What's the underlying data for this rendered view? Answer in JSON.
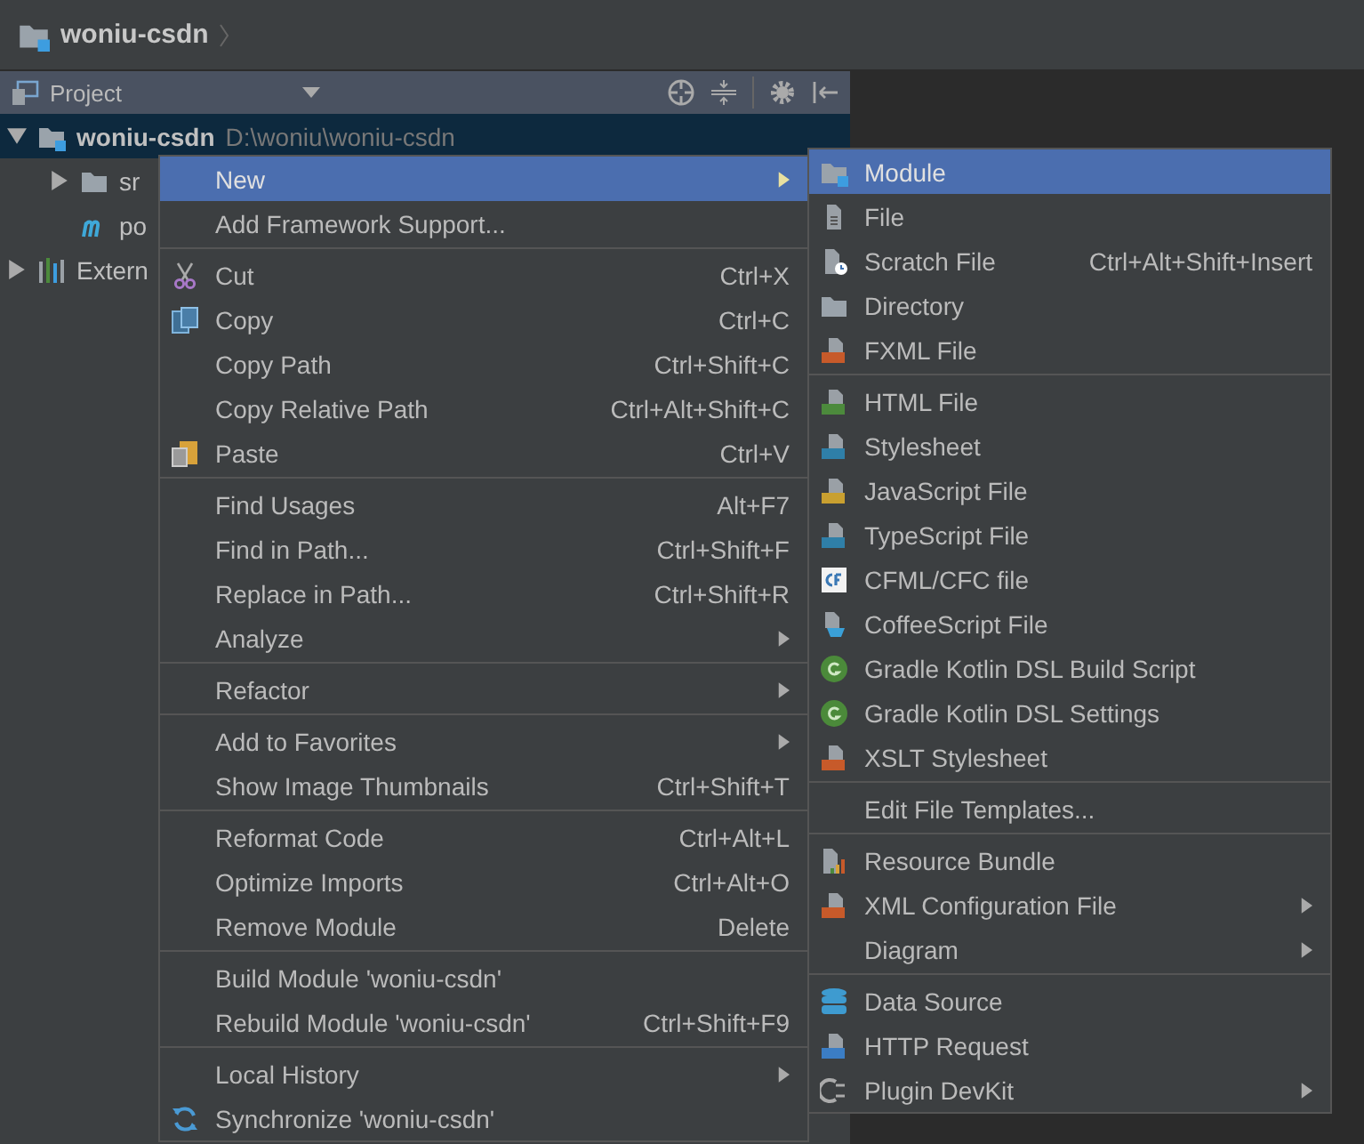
{
  "breadcrumb": {
    "label": "woniu-csdn"
  },
  "panel": {
    "title": "Project"
  },
  "tree": [
    {
      "label": "woniu-csdn",
      "path": "D:\\woniu\\woniu-csdn",
      "kind": "module",
      "expanded": true,
      "selected": true,
      "children": [
        {
          "label": "sr",
          "kind": "folder",
          "expanded": false,
          "selected": false
        },
        {
          "label": "po",
          "kind": "maven",
          "selected": false
        }
      ]
    },
    {
      "label": "Extern",
      "kind": "library",
      "expanded": false,
      "selected": false
    }
  ],
  "context_menu": {
    "items": [
      {
        "kind": "item",
        "label": "New",
        "submenu": true,
        "selected": true
      },
      {
        "kind": "item",
        "label": "Add Framework Support...",
        "submenu": false,
        "selected": false
      },
      {
        "kind": "separator"
      },
      {
        "kind": "item",
        "label": "Cut",
        "shortcut": "Ctrl+X",
        "submenu": false,
        "selected": false
      },
      {
        "kind": "item",
        "label": "Copy",
        "shortcut": "Ctrl+C",
        "submenu": false,
        "selected": false
      },
      {
        "kind": "item",
        "label": "Copy Path",
        "shortcut": "Ctrl+Shift+C",
        "submenu": false,
        "selected": false
      },
      {
        "kind": "item",
        "label": "Copy Relative Path",
        "shortcut": "Ctrl+Alt+Shift+C",
        "submenu": false,
        "selected": false
      },
      {
        "kind": "item",
        "label": "Paste",
        "shortcut": "Ctrl+V",
        "submenu": false,
        "selected": false
      },
      {
        "kind": "separator"
      },
      {
        "kind": "item",
        "label": "Find Usages",
        "shortcut": "Alt+F7",
        "submenu": false,
        "selected": false
      },
      {
        "kind": "item",
        "label": "Find in Path...",
        "shortcut": "Ctrl+Shift+F",
        "submenu": false,
        "selected": false
      },
      {
        "kind": "item",
        "label": "Replace in Path...",
        "shortcut": "Ctrl+Shift+R",
        "submenu": false,
        "selected": false
      },
      {
        "kind": "item",
        "label": "Analyze",
        "submenu": true,
        "selected": false
      },
      {
        "kind": "separator"
      },
      {
        "kind": "item",
        "label": "Refactor",
        "submenu": true,
        "selected": false
      },
      {
        "kind": "separator"
      },
      {
        "kind": "item",
        "label": "Add to Favorites",
        "submenu": true,
        "selected": false
      },
      {
        "kind": "item",
        "label": "Show Image Thumbnails",
        "shortcut": "Ctrl+Shift+T",
        "submenu": false,
        "selected": false
      },
      {
        "kind": "separator"
      },
      {
        "kind": "item",
        "label": "Reformat Code",
        "shortcut": "Ctrl+Alt+L",
        "submenu": false,
        "selected": false
      },
      {
        "kind": "item",
        "label": "Optimize Imports",
        "shortcut": "Ctrl+Alt+O",
        "submenu": false,
        "selected": false
      },
      {
        "kind": "item",
        "label": "Remove Module",
        "shortcut": "Delete",
        "submenu": false,
        "selected": false
      },
      {
        "kind": "separator"
      },
      {
        "kind": "item",
        "label": "Build Module 'woniu-csdn'",
        "submenu": false,
        "selected": false
      },
      {
        "kind": "item",
        "label": "Rebuild Module 'woniu-csdn'",
        "shortcut": "Ctrl+Shift+F9",
        "submenu": false,
        "selected": false
      },
      {
        "kind": "separator"
      },
      {
        "kind": "item",
        "label": "Local History",
        "submenu": true,
        "selected": false
      },
      {
        "kind": "item",
        "label": "Synchronize 'woniu-csdn'",
        "submenu": false,
        "selected": false
      }
    ]
  },
  "new_submenu": {
    "items": [
      {
        "kind": "item",
        "label": "Module",
        "submenu": false,
        "selected": true
      },
      {
        "kind": "item",
        "label": "File",
        "submenu": false,
        "selected": false
      },
      {
        "kind": "item",
        "label": "Scratch File",
        "shortcut": "Ctrl+Alt+Shift+Insert",
        "submenu": false,
        "selected": false
      },
      {
        "kind": "item",
        "label": "Directory",
        "submenu": false,
        "selected": false
      },
      {
        "kind": "item",
        "label": "FXML File",
        "submenu": false,
        "selected": false
      },
      {
        "kind": "separator"
      },
      {
        "kind": "item",
        "label": "HTML File",
        "submenu": false,
        "selected": false
      },
      {
        "kind": "item",
        "label": "Stylesheet",
        "submenu": false,
        "selected": false
      },
      {
        "kind": "item",
        "label": "JavaScript File",
        "submenu": false,
        "selected": false
      },
      {
        "kind": "item",
        "label": "TypeScript File",
        "submenu": false,
        "selected": false
      },
      {
        "kind": "item",
        "label": "CFML/CFC file",
        "submenu": false,
        "selected": false
      },
      {
        "kind": "item",
        "label": "CoffeeScript File",
        "submenu": false,
        "selected": false
      },
      {
        "kind": "item",
        "label": "Gradle Kotlin DSL Build Script",
        "submenu": false,
        "selected": false
      },
      {
        "kind": "item",
        "label": "Gradle Kotlin DSL Settings",
        "submenu": false,
        "selected": false
      },
      {
        "kind": "item",
        "label": "XSLT Stylesheet",
        "submenu": false,
        "selected": false
      },
      {
        "kind": "separator"
      },
      {
        "kind": "item",
        "label": "Edit File Templates...",
        "submenu": false,
        "selected": false
      },
      {
        "kind": "separator"
      },
      {
        "kind": "item",
        "label": "Resource Bundle",
        "submenu": false,
        "selected": false
      },
      {
        "kind": "item",
        "label": "XML Configuration File",
        "submenu": true,
        "selected": false
      },
      {
        "kind": "item",
        "label": "Diagram",
        "submenu": true,
        "selected": false
      },
      {
        "kind": "separator"
      },
      {
        "kind": "item",
        "label": "Data Source",
        "submenu": false,
        "selected": false
      },
      {
        "kind": "item",
        "label": "HTTP Request",
        "submenu": false,
        "selected": false
      },
      {
        "kind": "item",
        "label": "Plugin DevKit",
        "submenu": true,
        "selected": false
      }
    ]
  }
}
